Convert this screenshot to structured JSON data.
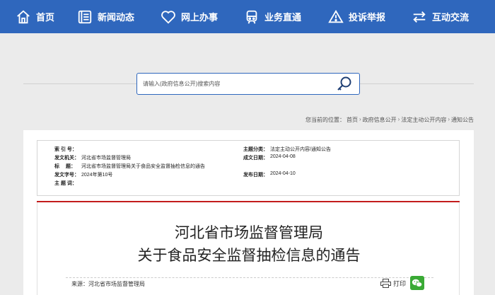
{
  "nav": {
    "items": [
      {
        "label": "首页",
        "icon": "home-icon"
      },
      {
        "label": "新闻动态",
        "icon": "news-icon"
      },
      {
        "label": "网上办事",
        "icon": "heart-icon"
      },
      {
        "label": "业务直通",
        "icon": "train-icon"
      },
      {
        "label": "投诉举报",
        "icon": "warning-icon"
      },
      {
        "label": "互动交流",
        "icon": "exchange-icon"
      }
    ]
  },
  "search": {
    "placeholder": "请输入(政府信息公开)搜索内容"
  },
  "breadcrumb": {
    "prefix": "您当前的位置：",
    "items": [
      "首页",
      "政府信息公开",
      "法定主动公开内容",
      "通知公告"
    ],
    "separator": "›"
  },
  "meta": {
    "index_key": "索 引 号：",
    "index_val": "",
    "issuer_key": "发文机关：",
    "issuer_val": "河北省市场监督管理局",
    "title_key": "标　 题：",
    "title_val": "河北省市场监督管理局关于食品安全监督抽检信息的通告",
    "docno_key": "发文字号：",
    "docno_val": "2024年第10号",
    "subject_key": "主 题 词：",
    "subject_val": "",
    "category_key": "主题分类：",
    "category_val": "法定主动公开内容/通知公告",
    "created_key": "成文日期：",
    "created_val": "2024-04-08",
    "published_key": "发布日期：",
    "published_val": "2024-04-10"
  },
  "document": {
    "title_line1": "河北省市场监督管理局",
    "title_line2": "关于食品安全监督抽检信息的通告",
    "source": "来源：河北省市场监督管理局",
    "print_label": "打印"
  },
  "colors": {
    "nav_bg": "#2f67bd",
    "accent_red": "#c31c1c",
    "wechat_green": "#3aaa35"
  }
}
